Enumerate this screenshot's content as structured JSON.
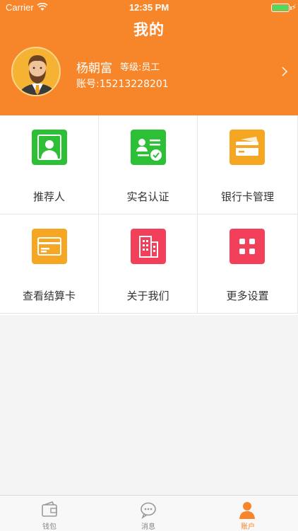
{
  "status_bar": {
    "carrier": "Carrier",
    "time": "12:35 PM"
  },
  "header": {
    "title": "我的"
  },
  "profile": {
    "name": "杨朝富",
    "level": "等级:员工",
    "account": "账号:15213228201"
  },
  "menu": {
    "items": [
      {
        "label": "推荐人",
        "icon": "contact-card-icon",
        "color": "#2dc036"
      },
      {
        "label": "实名认证",
        "icon": "id-verified-icon",
        "color": "#2dc036"
      },
      {
        "label": "银行卡管理",
        "icon": "bank-card-icon",
        "color": "#f5a623"
      },
      {
        "label": "查看结算卡",
        "icon": "settlement-card-icon",
        "color": "#f5a623"
      },
      {
        "label": "关于我们",
        "icon": "building-icon",
        "color": "#f2405b"
      },
      {
        "label": "更多设置",
        "icon": "grid-settings-icon",
        "color": "#f2405b"
      }
    ]
  },
  "tabbar": {
    "items": [
      {
        "label": "钱包",
        "icon": "wallet-icon"
      },
      {
        "label": "消息",
        "icon": "chat-bubble-icon"
      },
      {
        "label": "账户",
        "icon": "person-icon",
        "active": true
      }
    ]
  },
  "colors": {
    "brand": "#f7862a"
  }
}
